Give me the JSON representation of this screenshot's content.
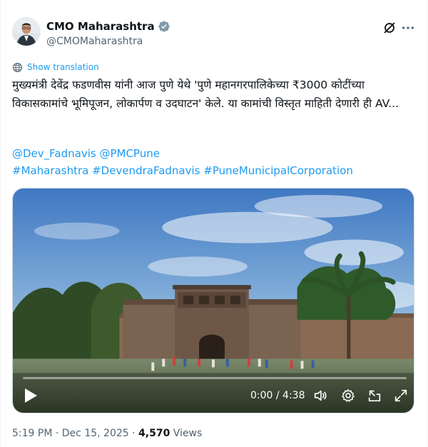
{
  "author": {
    "display_name": "CMO Maharashtra",
    "handle": "@CMOMaharashtra",
    "verified_color": "#829aab"
  },
  "actions": {
    "grok_icon": "grok-icon",
    "more_icon": "more-icon"
  },
  "translate": {
    "label": "Show translation"
  },
  "post": {
    "text": "मुख्यमंत्री देवेंद्र फडणवीस यांनी आज पुणे येथे 'पुणे महानगरपालिकेच्या ₹3000 कोटींच्या विकासकामांचे भूमिपूजन, लोकार्पण व उदघाटन' केले. या कामांची विस्तृत माहिती देणारी ही AV...",
    "mentions": [
      "@Dev_Fadnavis",
      "@PMCPune"
    ],
    "hashtags": [
      "#Maharashtra",
      "#DevendraFadnavis",
      "#PuneMunicipalCorporation"
    ]
  },
  "video": {
    "time_display": "0:00 / 4:38",
    "progress": 0,
    "icons": [
      "play-icon",
      "volume-icon",
      "settings-icon",
      "pip-icon",
      "fullscreen-icon"
    ]
  },
  "meta": {
    "time": "5:19 PM",
    "date": "Dec 15, 2025",
    "separator": "·",
    "views_count": "4,570",
    "views_label": "Views"
  },
  "colors": {
    "link": "#1d9bf0",
    "text": "#0f1419",
    "secondary": "#536471"
  }
}
